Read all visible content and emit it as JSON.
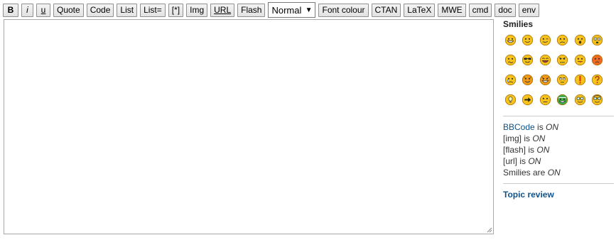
{
  "toolbar": {
    "bold": "B",
    "italic": "i",
    "underline": "u",
    "quote": "Quote",
    "code": "Code",
    "list": "List",
    "list_ordered": "List=",
    "list_item": "[*]",
    "img": "Img",
    "url": "URL",
    "flash": "Flash",
    "font_size_value": "Normal",
    "font_colour": "Font colour",
    "ctan": "CTAN",
    "latex": "LaTeX",
    "mwe": "MWE",
    "cmd": "cmd",
    "doc": "doc",
    "env": "env"
  },
  "editor": {
    "value": ""
  },
  "sidebar": {
    "smilies_title": "Smilies",
    "smilies": [
      {
        "name": "grin"
      },
      {
        "name": "smile"
      },
      {
        "name": "wink"
      },
      {
        "name": "sad"
      },
      {
        "name": "surprised"
      },
      {
        "name": "shocked"
      },
      {
        "name": "confused"
      },
      {
        "name": "cool"
      },
      {
        "name": "laughing"
      },
      {
        "name": "mad"
      },
      {
        "name": "razz"
      },
      {
        "name": "embarrassed"
      },
      {
        "name": "crying"
      },
      {
        "name": "evil"
      },
      {
        "name": "twisted-evil"
      },
      {
        "name": "rolling-eyes"
      },
      {
        "name": "exclaim"
      },
      {
        "name": "question"
      },
      {
        "name": "idea"
      },
      {
        "name": "arrow"
      },
      {
        "name": "neutral"
      },
      {
        "name": "green"
      },
      {
        "name": "geek"
      },
      {
        "name": "uber-geek"
      }
    ],
    "status": {
      "bbcode_label": "BBCode",
      "bbcode_mid": " is ",
      "bbcode_state": "ON",
      "img_label": "[img] is ",
      "img_state": "ON",
      "flash_label": "[flash] is ",
      "flash_state": "ON",
      "url_label": "[url] is ",
      "url_state": "ON",
      "smilies_label": "Smilies are ",
      "smilies_state": "ON"
    },
    "topic_review": "Topic review"
  },
  "colors": {
    "smiley_yellow": "#f6c21b",
    "smiley_orange": "#f19a1a",
    "smiley_red": "#ee6a1e",
    "smiley_green": "#3fae49",
    "link": "#105289"
  }
}
